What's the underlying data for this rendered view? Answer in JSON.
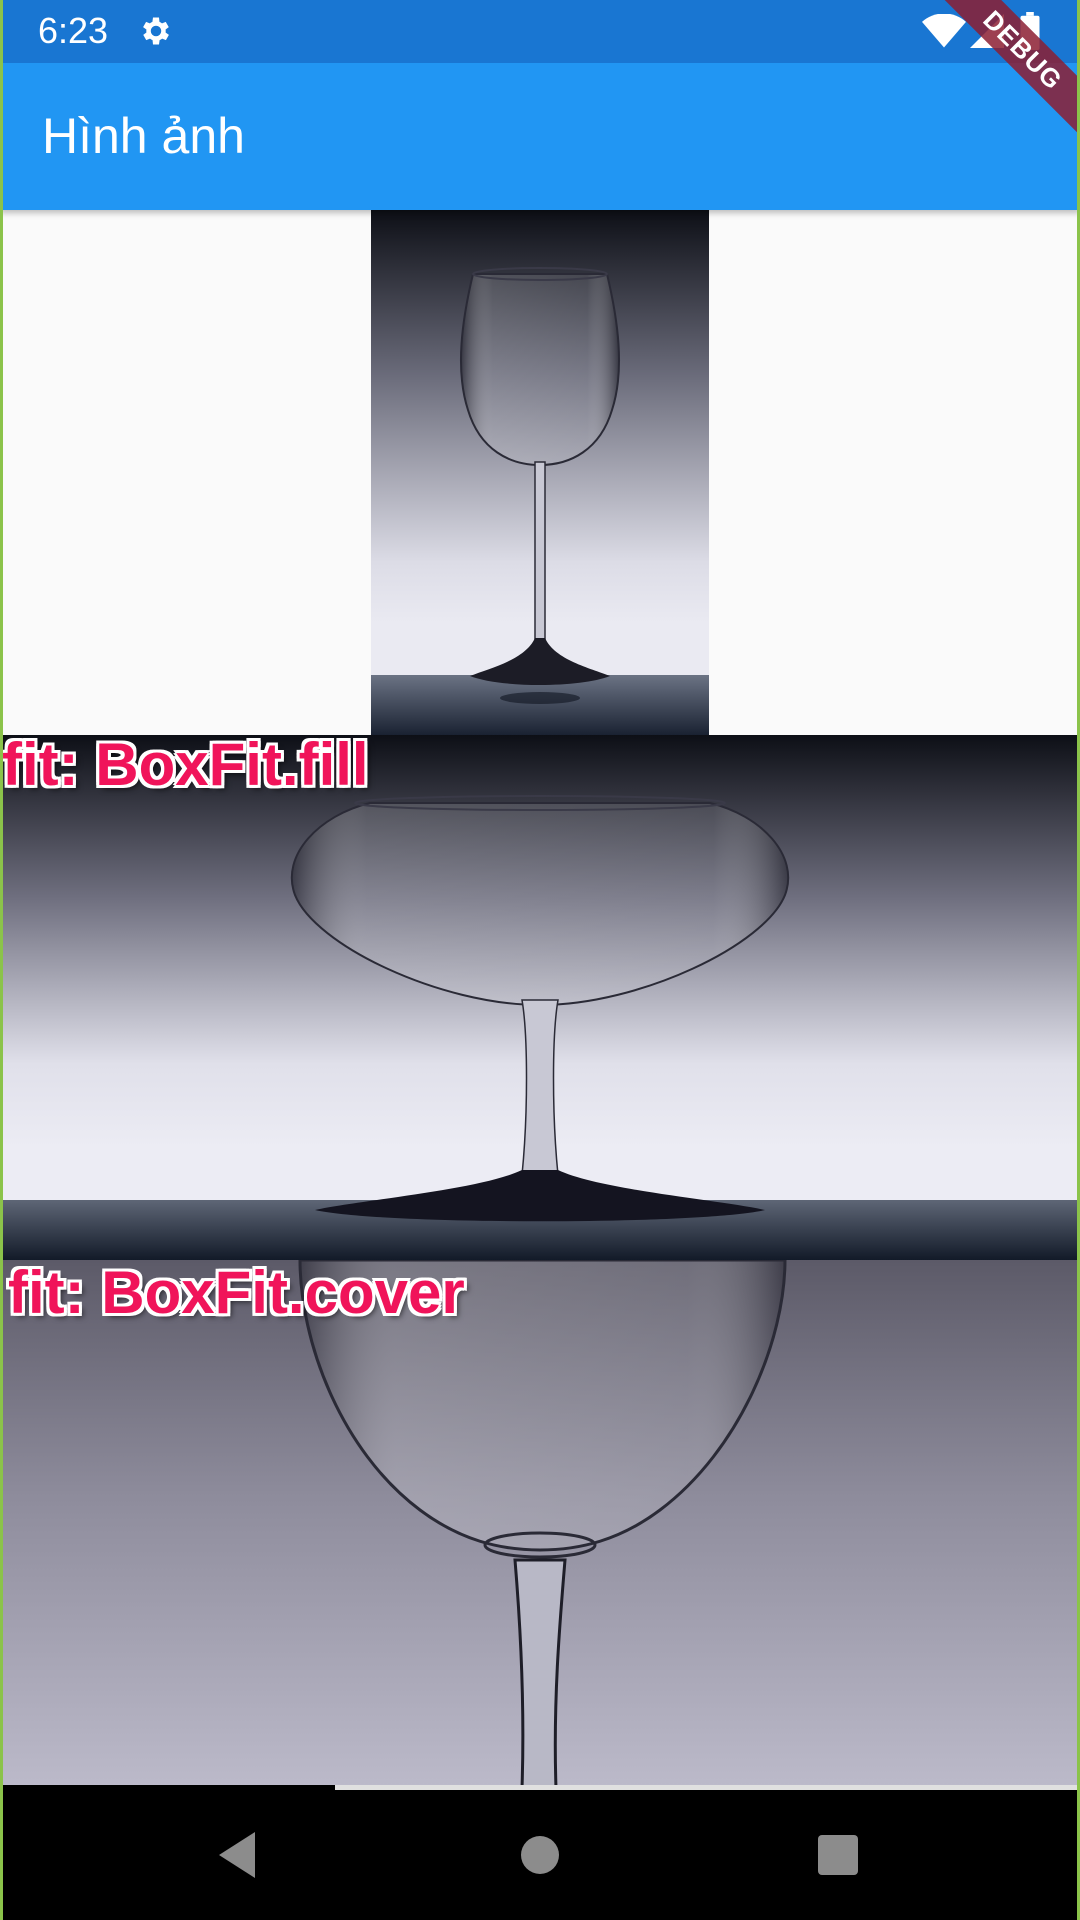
{
  "status_bar": {
    "time": "6:23",
    "icons": [
      "gear-icon",
      "wifi-icon",
      "cell-signal-icon",
      "battery-icon"
    ]
  },
  "app_bar": {
    "title": "Hình ảnh",
    "debug_banner": "DEBUG",
    "color": "#2196f3"
  },
  "images": [
    {
      "caption": ""
    },
    {
      "caption": "fit: BoxFit.fill"
    },
    {
      "caption": "fit: BoxFit.cover"
    }
  ],
  "scroll_progress": 0.31,
  "nav_bar": {
    "buttons": [
      "back-icon",
      "home-icon",
      "recents-icon"
    ]
  },
  "colors": {
    "status_bar": "#1976d2",
    "label_text": "#f0145a",
    "frame": "#8bc34a"
  }
}
